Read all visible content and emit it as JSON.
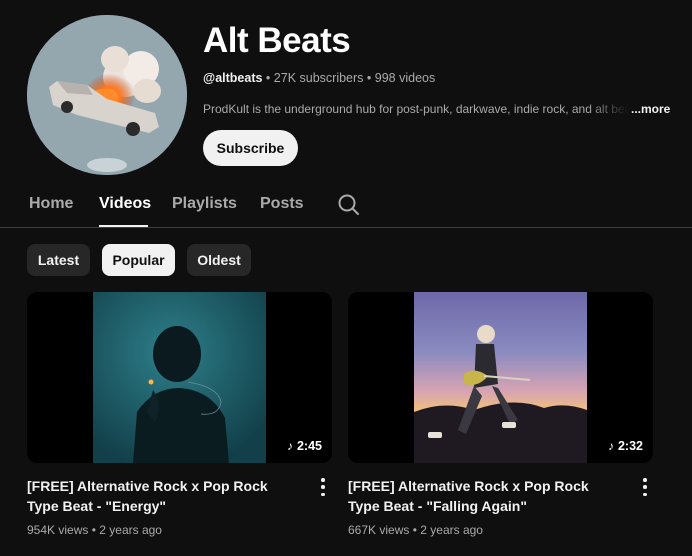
{
  "channel": {
    "name": "Alt Beats",
    "handle": "@altbeats",
    "subscribers": "27K subscribers",
    "videos_count": "998 videos",
    "separator": "•",
    "description": "ProdKult is the underground hub for post-punk, darkwave, indie rock, and alt beat",
    "more_label": "...more",
    "subscribe_label": "Subscribe",
    "avatar_icon": "flaming-car-avatar"
  },
  "tabs": [
    {
      "label": "Home",
      "active": false
    },
    {
      "label": "Videos",
      "active": true
    },
    {
      "label": "Playlists",
      "active": false
    },
    {
      "label": "Posts",
      "active": false
    }
  ],
  "search_icon": "search-icon",
  "chips": [
    {
      "label": "Latest",
      "selected": false
    },
    {
      "label": "Popular",
      "selected": true
    },
    {
      "label": "Oldest",
      "selected": false
    }
  ],
  "videos": [
    {
      "title": "[FREE] Alternative Rock x Pop Rock Type Beat - \"Energy\"",
      "duration": "2:45",
      "duration_icon": "music-note-icon",
      "views": "954K views",
      "age": "2 years ago"
    },
    {
      "title": "[FREE] Alternative Rock x Pop Rock Type Beat - \"Falling Again\"",
      "duration": "2:32",
      "duration_icon": "music-note-icon",
      "views": "667K views",
      "age": "2 years ago"
    }
  ],
  "colors": {
    "background": "#0f0f0f",
    "chip": "#272727",
    "chip_selected": "#f1f1f1",
    "secondary_text": "#aaaaaa"
  }
}
